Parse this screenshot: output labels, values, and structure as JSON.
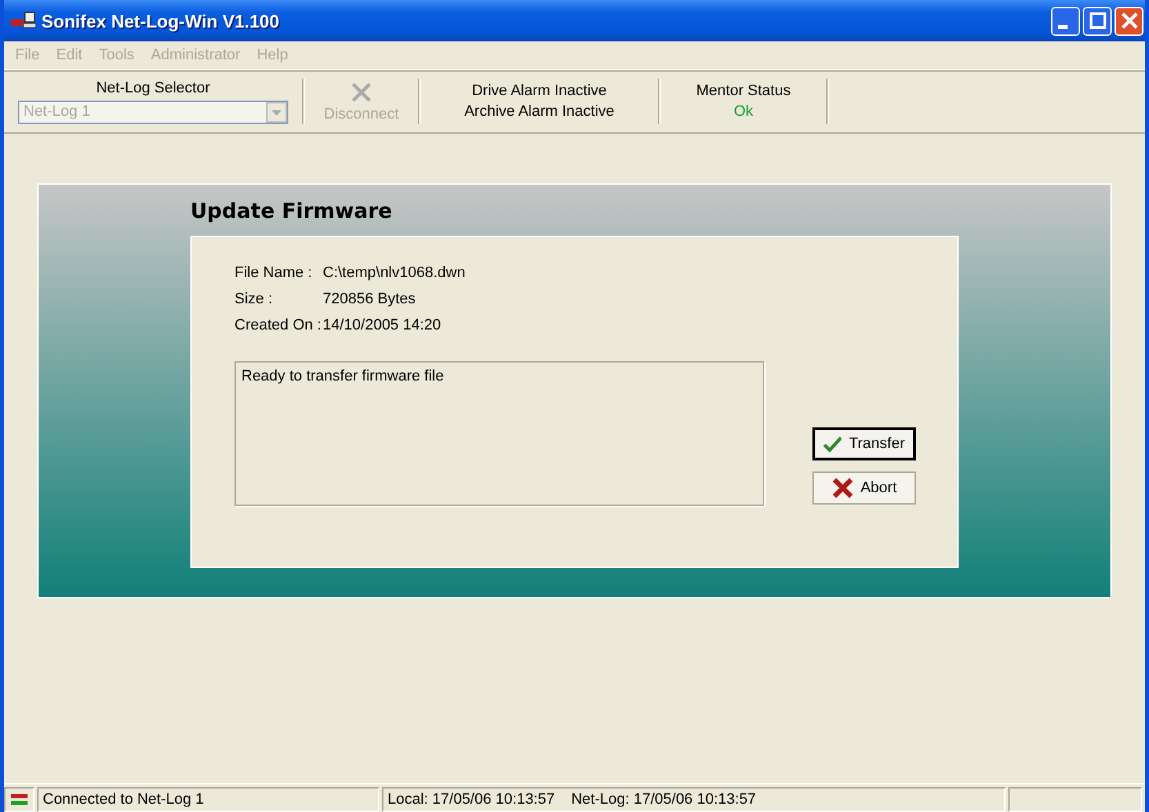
{
  "window": {
    "title": "Sonifex Net-Log-Win V1.100"
  },
  "menu": [
    {
      "label": "File",
      "disabled": true
    },
    {
      "label": "Edit",
      "disabled": true
    },
    {
      "label": "Tools",
      "disabled": true
    },
    {
      "label": "Administrator",
      "disabled": true
    },
    {
      "label": "Help",
      "disabled": true
    }
  ],
  "toolbar": {
    "selector_label": "Net-Log Selector",
    "selector": {
      "value": "Net-Log 1",
      "disabled": true
    },
    "disconnect": {
      "label": "Disconnect",
      "disabled": true
    },
    "alarms": [
      "Drive Alarm Inactive",
      "Archive Alarm Inactive"
    ],
    "mentor_label": "Mentor Status",
    "mentor_status": "Ok"
  },
  "panel": {
    "title": "Update Firmware",
    "fields": [
      {
        "label": "File Name :",
        "value": "C:\\temp\\nlv1068.dwn"
      },
      {
        "label": "Size :",
        "value": "720856 Bytes"
      },
      {
        "label": "Created On :",
        "value": "14/10/2005 14:20"
      }
    ],
    "message": "Ready to transfer firmware file",
    "buttons": [
      {
        "kind": "transfer",
        "label": "Transfer",
        "default": true
      },
      {
        "kind": "abort",
        "label": "Abort",
        "default": false
      }
    ]
  },
  "status_bar": {
    "connection": "Connected to Net-Log 1",
    "local": "Local: 17/05/06 10:13:57",
    "netlog": "Net-Log: 17/05/06 10:13:57"
  }
}
